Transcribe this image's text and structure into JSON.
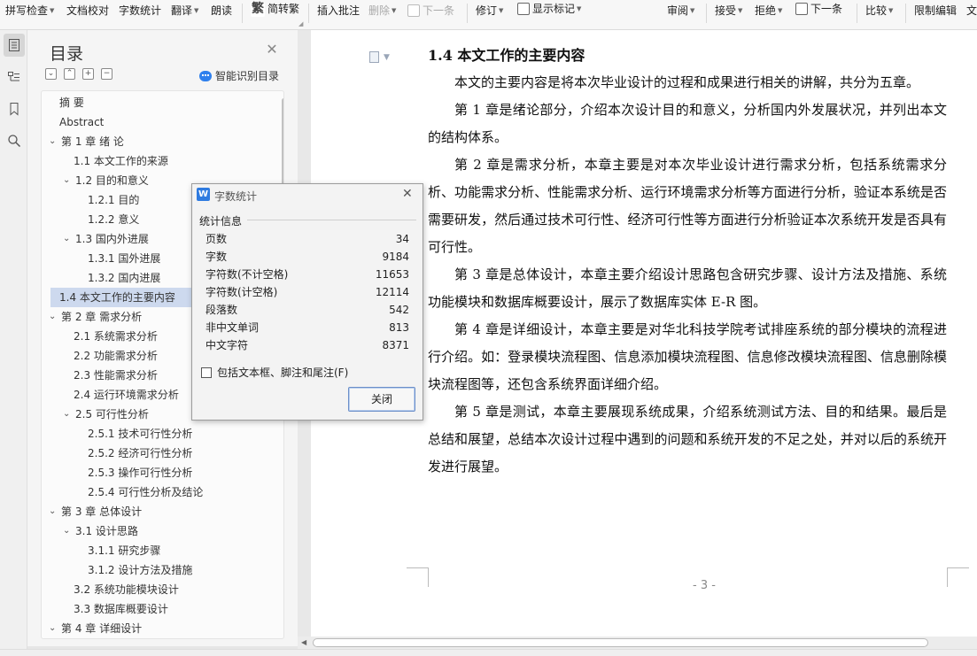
{
  "ribbon": {
    "spell_check": "拼写检查",
    "proofread": "文档校对",
    "word_count": "字数统计",
    "translate": "翻译",
    "read_aloud": "朗读",
    "simp_trad": "简转繁",
    "insert_comment": "插入批注",
    "delete": "删除",
    "next_comment": "下一条",
    "revise": "修订",
    "show_marks": "显示标记",
    "review": "审阅",
    "accept": "接受",
    "reject": "拒绝",
    "next_change": "下一条",
    "compare": "比较",
    "restrict_edit": "限制编辑",
    "doc_more": "文"
  },
  "nav": {
    "title": "目录",
    "smart_recognize": "智能识别目录",
    "items": [
      {
        "label": "摘    要",
        "level": 0
      },
      {
        "label": "Abstract",
        "level": 0
      },
      {
        "label": "第 1 章  绪      论",
        "level": 0
      },
      {
        "label": "1.1 本文工作的来源",
        "level": 1
      },
      {
        "label": "1.2 目的和意义",
        "level": 1
      },
      {
        "label": "1.2.1  目的",
        "level": 2
      },
      {
        "label": "1.2.2 意义",
        "level": 2
      },
      {
        "label": "1.3 国内外进展",
        "level": 1
      },
      {
        "label": "1.3.1 国外进展",
        "level": 2
      },
      {
        "label": "1.3.2 国内进展",
        "level": 2
      },
      {
        "label": "1.4 本文工作的主要内容",
        "level": 1
      },
      {
        "label": "第 2 章  需求分析",
        "level": 0
      },
      {
        "label": "2.1 系统需求分析",
        "level": 1
      },
      {
        "label": "2.2 功能需求分析",
        "level": 1
      },
      {
        "label": "2.3 性能需求分析",
        "level": 1
      },
      {
        "label": "2.4 运行环境需求分析",
        "level": 1
      },
      {
        "label": "2.5 可行性分析",
        "level": 1
      },
      {
        "label": "2.5.1 技术可行性分析",
        "level": 2
      },
      {
        "label": "2.5.2 经济可行性分析",
        "level": 2
      },
      {
        "label": "2.5.3 操作可行性分析",
        "level": 2
      },
      {
        "label": "2.5.4 可行性分析及结论",
        "level": 2
      },
      {
        "label": "第 3 章  总体设计",
        "level": 0
      },
      {
        "label": "3.1 设计思路",
        "level": 1
      },
      {
        "label": "3.1.1 研究步骤",
        "level": 2
      },
      {
        "label": "3.1.2 设计方法及措施",
        "level": 2
      },
      {
        "label": "3.2 系统功能模块设计",
        "level": 1
      },
      {
        "label": "3.3 数据库概要设计",
        "level": 1
      },
      {
        "label": "第 4 章  详细设计",
        "level": 0
      }
    ]
  },
  "document": {
    "heading": "1.4 本文工作的主要内容",
    "paragraphs": [
      "本文的主要内容是将本次毕业设计的过程和成果进行相关的讲解，共分为五章。",
      "第 1 章是绪论部分，介绍本次设计目的和意义，分析国内外发展状况，并列出本文的结构体系。",
      "第 2 章是需求分析，本章主要是对本次毕业设计进行需求分析，包括系统需求分析、功能需求分析、性能需求分析、运行环境需求分析等方面进行分析，验证本系统是否需要研发，然后通过技术可行性、经济可行性等方面进行分析验证本次系统开发是否具有可行性。",
      "第 3 章是总体设计，本章主要介绍设计思路包含研究步骤、设计方法及措施、系统功能模块和数据库概要设计，展示了数据库实体 E-R 图。",
      "第 4 章是详细设计，本章主要是对华北科技学院考试排座系统的部分模块的流程进行介绍。如：登录模块流程图、信息添加模块流程图、信息修改模块流程图、信息删除模块流程图等，还包含系统界面详细介绍。",
      "第 5 章是测试，本章主要展现系统成果，介绍系统测试方法、目的和结果。最后是总结和展望，总结本次设计过程中遇到的问题和系统开发的不足之处，并对以后的系统开发进行展望。"
    ],
    "page_number": "- 3 -"
  },
  "dialog": {
    "title": "字数统计",
    "group_label": "统计信息",
    "stats": [
      {
        "label": "页数",
        "value": "34"
      },
      {
        "label": "字数",
        "value": "9184"
      },
      {
        "label": "字符数(不计空格)",
        "value": "11653"
      },
      {
        "label": "字符数(计空格)",
        "value": "12114"
      },
      {
        "label": "段落数",
        "value": "542"
      },
      {
        "label": "非中文单词",
        "value": "813"
      },
      {
        "label": "中文字符",
        "value": "8371"
      }
    ],
    "checkbox_label": "包括文本框、脚注和尾注(F)",
    "checkbox_checked": false,
    "close_button": "关闭"
  },
  "colors": {
    "selection": "#cdd9ee",
    "accent": "#2f7be0"
  }
}
